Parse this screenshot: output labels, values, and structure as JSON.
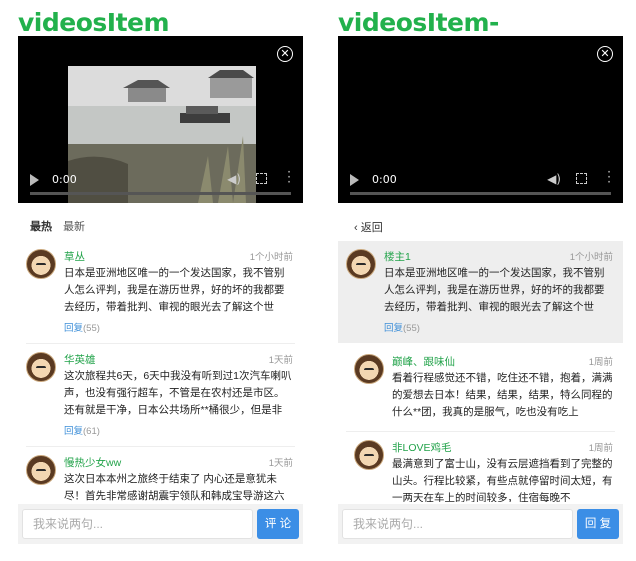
{
  "left": {
    "title": "videosItem",
    "video": {
      "time": "0:00"
    },
    "tabs": {
      "hot": "最热",
      "new": "最新"
    },
    "comments": [
      {
        "name": "草丛",
        "time": "1个小时前",
        "content": "日本是亚洲地区唯一的一个发达国家，我不管别人怎么评判，我是在游历世界，好的坏的我都要去经历，带着批判、审视的眼光去了解这个世",
        "reply_label": "回复",
        "reply_count": "(55)"
      },
      {
        "name": "华英雄",
        "time": "1天前",
        "content": "这次旅程共6天，6天中我没有听到过1次汽车喇叭声，也没有强行超车，不管是在农村还是市区。还有就是干净，日本公共场所**桶很少，但是非",
        "reply_label": "回复",
        "reply_count": "(61)"
      },
      {
        "name": "慢热少女ww",
        "time": "1天前",
        "content": "这次日本本州之旅终于结束了 内心还是意犹未尽！首先非常感谢胡震宇领队和韩成宝导游这六",
        "reply_label": "",
        "reply_count": ""
      }
    ],
    "input_placeholder": "我来说两句...",
    "submit_label": "评 论"
  },
  "right": {
    "title": "videosItem-commentItem",
    "video": {
      "time": "0:00"
    },
    "back_label": "返回",
    "main_comment": {
      "name": "楼主1",
      "time": "1个小时前",
      "content": "日本是亚洲地区唯一的一个发达国家，我不管别人怎么评判，我是在游历世界，好的坏的我都要去经历，带着批判、审视的眼光去了解这个世",
      "reply_label": "回复",
      "reply_count": "(55)"
    },
    "replies": [
      {
        "name": "巅峰、跟味仙",
        "time": "1周前",
        "content": "看着行程感觉还不错，吃住还不错，抱着，满满的爱想去日本！结果，结果，结果，特么同程的什么**团，我真的是服气，吃也没有吃上"
      },
      {
        "name": "非LOVE鸡毛",
        "time": "1周前",
        "content": "最满意到了富士山，没有云层遮挡看到了完整的山头。行程比较紧，有些点就停留时间太短，有一两天在车上的时间较多，住宿每晚不"
      }
    ],
    "input_placeholder": "我来说两句...",
    "submit_label": "回 复"
  }
}
